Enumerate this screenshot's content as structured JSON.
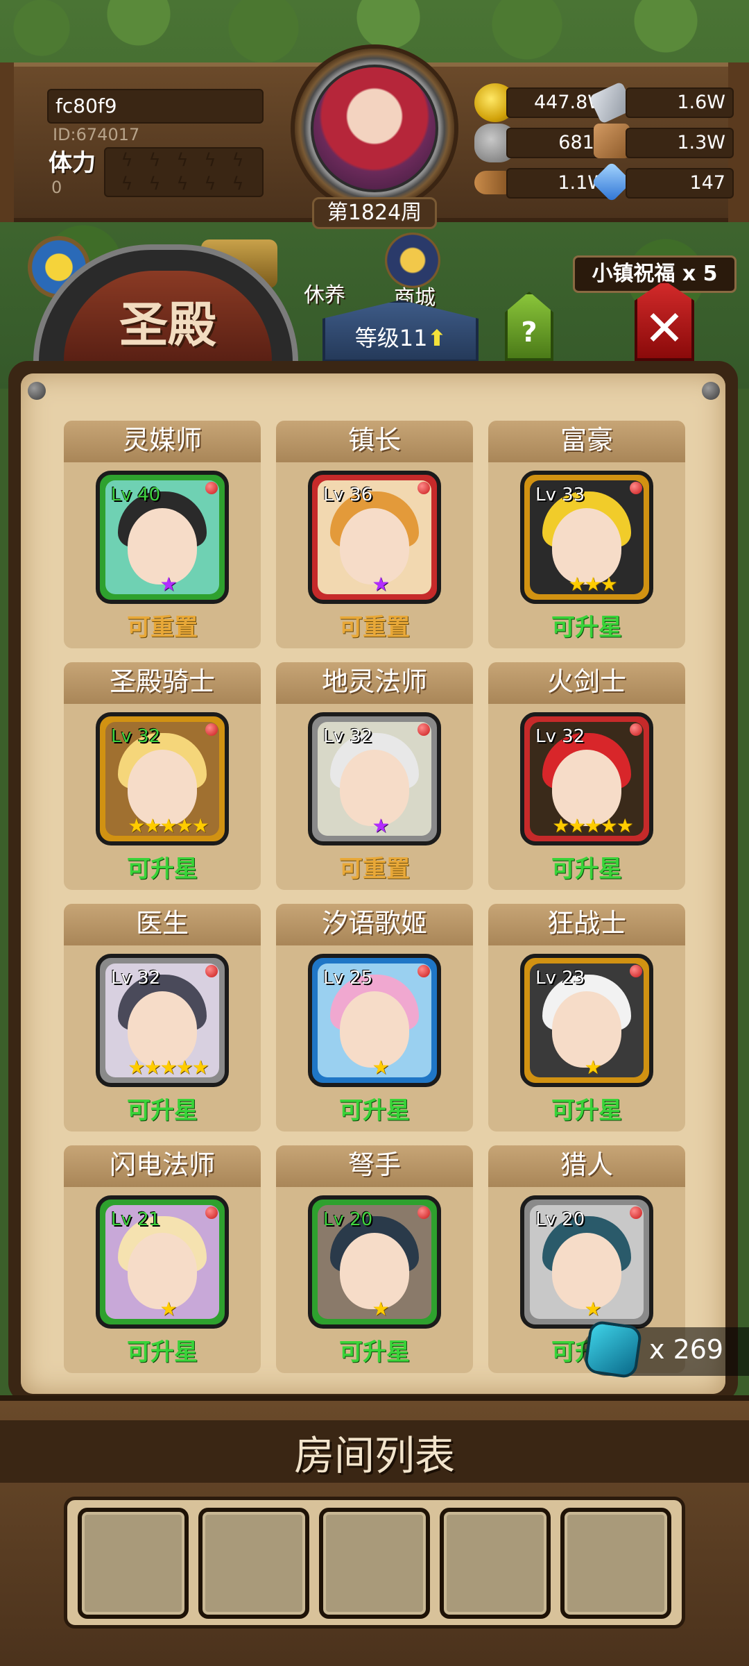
{
  "player": {
    "name": "fc80f9",
    "id_text": "ID:674017",
    "stamina_label": "体力",
    "stamina_value": "0",
    "week_label": "第1824周"
  },
  "resources": [
    {
      "icon": "gold-coin-icon",
      "value": "447.8W"
    },
    {
      "icon": "iron-ingot-icon",
      "value": "1.6W"
    },
    {
      "icon": "stone-icon",
      "value": "6813"
    },
    {
      "icon": "leather-icon",
      "value": "1.3W"
    },
    {
      "icon": "wood-log-icon",
      "value": "1.1W"
    },
    {
      "icon": "crystal-icon",
      "value": "147"
    }
  ],
  "nav": {
    "rest_label": "休养",
    "shop_label": "商城"
  },
  "building": {
    "title": "圣殿",
    "level_label": "等级11",
    "help_label": "?",
    "blessing_label": "小镇祝福 x 5"
  },
  "heroes": [
    {
      "name": "灵媒师",
      "level": "Lv 40",
      "stars": "★",
      "star_color": "purple",
      "status": "可重置",
      "status_type": "gold",
      "frame": "green",
      "hair": "#2a2a2a",
      "bg": "#6fd1b3"
    },
    {
      "name": "镇长",
      "level": "Lv 36",
      "stars": "★",
      "star_color": "purple",
      "status": "可重置",
      "status_type": "gold",
      "frame": "red",
      "hair": "#e39a3a",
      "bg": "#f2d8b0"
    },
    {
      "name": "富豪",
      "level": "Lv 33",
      "stars": "★★★",
      "star_color": "gold",
      "status": "可升星",
      "status_type": "green",
      "frame": "gold",
      "hair": "#f1cc2a",
      "bg": "#2a2a2a"
    },
    {
      "name": "圣殿骑士",
      "level": "Lv 32",
      "stars": "★★★★★",
      "star_color": "gold",
      "status": "可升星",
      "status_type": "green",
      "frame": "gold",
      "hair": "#f5d67a",
      "bg": "#a07030"
    },
    {
      "name": "地灵法师",
      "level": "Lv 32",
      "stars": "★",
      "star_color": "purple",
      "status": "可重置",
      "status_type": "gold",
      "frame": "grey",
      "hair": "#e8e8e8",
      "bg": "#d8d8c8"
    },
    {
      "name": "火剑士",
      "level": "Lv 32",
      "stars": "★★★★★",
      "star_color": "gold",
      "status": "可升星",
      "status_type": "green",
      "frame": "red",
      "hair": "#d8262a",
      "bg": "#3a2a1a"
    },
    {
      "name": "医生",
      "level": "Lv 32",
      "stars": "★★★★★",
      "star_color": "gold",
      "status": "可升星",
      "status_type": "green",
      "frame": "grey",
      "hair": "#4a4a5a",
      "bg": "#d8d0e0"
    },
    {
      "name": "汐语歌姬",
      "level": "Lv 25",
      "stars": "★",
      "star_color": "gold",
      "status": "可升星",
      "status_type": "green",
      "frame": "blue",
      "hair": "#f0a8d0",
      "bg": "#9ad0f0"
    },
    {
      "name": "狂战士",
      "level": "Lv 23",
      "stars": "★",
      "star_color": "gold",
      "status": "可升星",
      "status_type": "green",
      "frame": "gold",
      "hair": "#f2f2f2",
      "bg": "#3a3a3a"
    },
    {
      "name": "闪电法师",
      "level": "Lv 21",
      "stars": "★",
      "star_color": "gold",
      "status": "可升星",
      "status_type": "green",
      "frame": "green",
      "hair": "#f5e2b0",
      "bg": "#c8a8d8"
    },
    {
      "name": "弩手",
      "level": "Lv 20",
      "stars": "★",
      "star_color": "gold",
      "status": "可升星",
      "status_type": "green",
      "frame": "green",
      "hair": "#2a3a4a",
      "bg": "#8a7a6a"
    },
    {
      "name": "猎人",
      "level": "Lv 20",
      "stars": "★",
      "star_color": "gold",
      "status": "可升星",
      "status_type": "green",
      "frame": "grey",
      "hair": "#2a5a6a",
      "bg": "#c8c8c8"
    }
  ],
  "token": {
    "icon": "cyan-token-icon",
    "value": "x 269"
  },
  "room_list": {
    "title": "房间列表",
    "slot_count": 5
  }
}
